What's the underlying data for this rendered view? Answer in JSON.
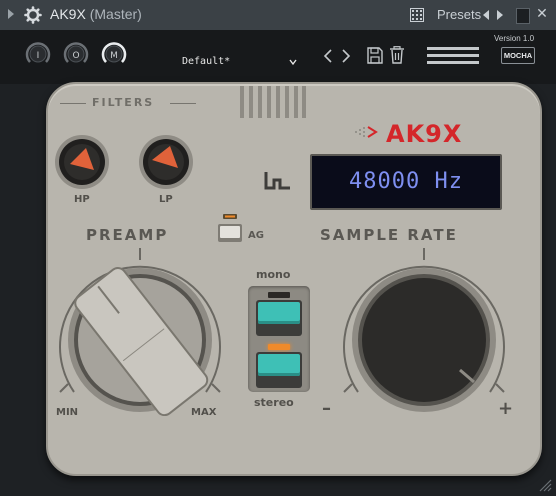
{
  "window": {
    "title": "AK9X",
    "subtitle": "(Master)",
    "presets_label": "Presets"
  },
  "toolbar": {
    "knobs": [
      "I",
      "O",
      "M"
    ],
    "preset_name": "Default*",
    "version": "Version 1.0",
    "vendor_badge": "MOCHA"
  },
  "device": {
    "brand": "AK9X",
    "filters_label": "FILTERS",
    "hp_label": "HP",
    "lp_label": "LP",
    "display_value": "48000 Hz",
    "preamp_label": "PREAMP",
    "ag_label": "AG",
    "sample_rate_label": "SAMPLE RATE",
    "preamp_min": "MIN",
    "preamp_max": "MAX",
    "sr_minus": "–",
    "sr_plus": "+",
    "mode_top": "mono",
    "mode_bottom": "stereo",
    "mode_selected": "stereo"
  },
  "colors": {
    "accent_red": "#d4262a",
    "display_text": "#7e8ff0",
    "mode_button": "#3ec0b6",
    "filter_knob_pointer": "#e0623a",
    "led_on": "#f08a2a"
  },
  "icons": {
    "title_menu": "play-arrow-icon",
    "plugin": "gear-icon",
    "grid": "grid-icon",
    "save": "save-icon",
    "delete": "trash-icon"
  }
}
